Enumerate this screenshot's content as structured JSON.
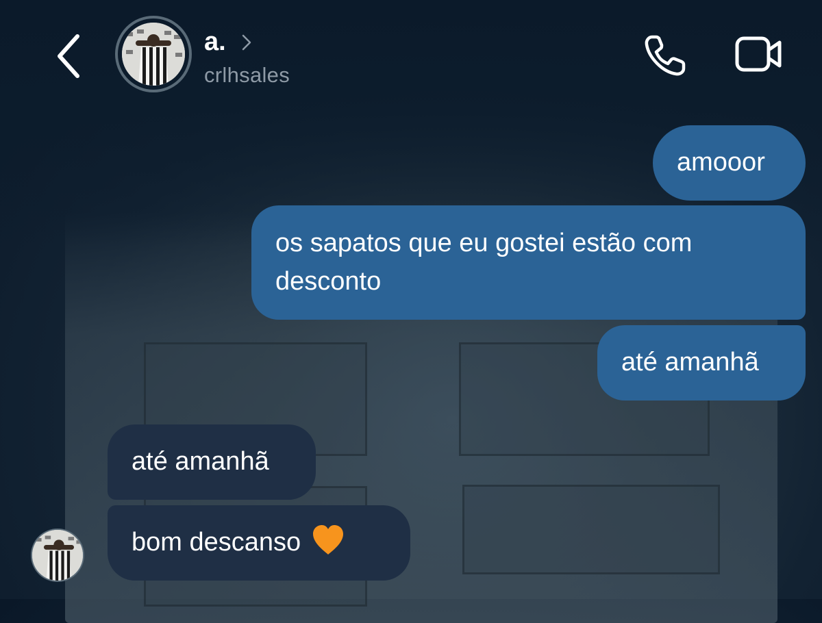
{
  "header": {
    "contact_name": "a.",
    "username": "crlhsales"
  },
  "messages": [
    {
      "direction": "sent",
      "text": "amooor"
    },
    {
      "direction": "sent",
      "text_line1": "os sapatos que eu gostei estão com",
      "text_line2": "desconto"
    },
    {
      "direction": "sent",
      "text": "até amanhã"
    },
    {
      "direction": "received",
      "text": "até amanhã"
    },
    {
      "direction": "received",
      "text": "bom descanso",
      "emoji": "orange-heart-icon"
    }
  ],
  "colors": {
    "sent_bubble": "#2b6396",
    "received_bubble": "#1f2f45",
    "username": "#8e9aa6",
    "heart": "#f7941d"
  }
}
